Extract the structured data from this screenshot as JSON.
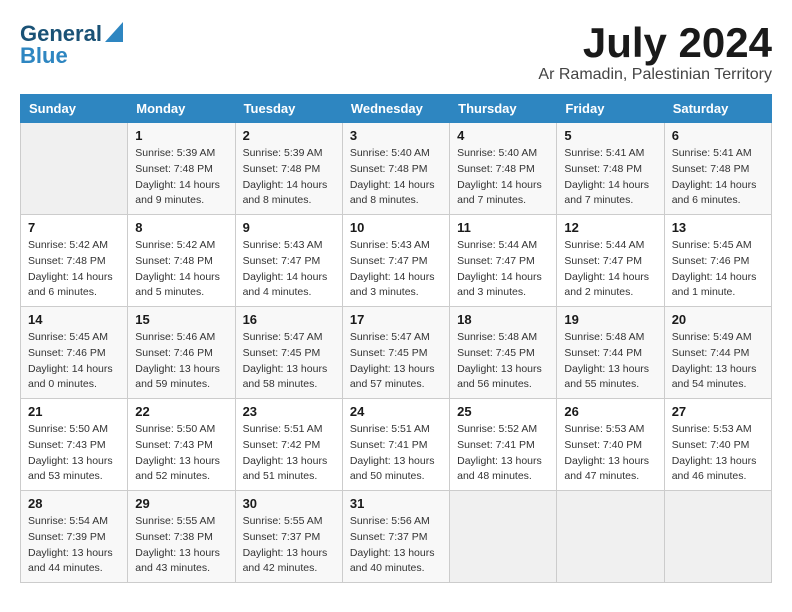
{
  "header": {
    "logo_line1": "General",
    "logo_line2": "Blue",
    "month": "July 2024",
    "location": "Ar Ramadin, Palestinian Territory"
  },
  "weekdays": [
    "Sunday",
    "Monday",
    "Tuesday",
    "Wednesday",
    "Thursday",
    "Friday",
    "Saturday"
  ],
  "weeks": [
    [
      {
        "day": "",
        "info": ""
      },
      {
        "day": "1",
        "info": "Sunrise: 5:39 AM\nSunset: 7:48 PM\nDaylight: 14 hours\nand 9 minutes."
      },
      {
        "day": "2",
        "info": "Sunrise: 5:39 AM\nSunset: 7:48 PM\nDaylight: 14 hours\nand 8 minutes."
      },
      {
        "day": "3",
        "info": "Sunrise: 5:40 AM\nSunset: 7:48 PM\nDaylight: 14 hours\nand 8 minutes."
      },
      {
        "day": "4",
        "info": "Sunrise: 5:40 AM\nSunset: 7:48 PM\nDaylight: 14 hours\nand 7 minutes."
      },
      {
        "day": "5",
        "info": "Sunrise: 5:41 AM\nSunset: 7:48 PM\nDaylight: 14 hours\nand 7 minutes."
      },
      {
        "day": "6",
        "info": "Sunrise: 5:41 AM\nSunset: 7:48 PM\nDaylight: 14 hours\nand 6 minutes."
      }
    ],
    [
      {
        "day": "7",
        "info": "Sunrise: 5:42 AM\nSunset: 7:48 PM\nDaylight: 14 hours\nand 6 minutes."
      },
      {
        "day": "8",
        "info": "Sunrise: 5:42 AM\nSunset: 7:48 PM\nDaylight: 14 hours\nand 5 minutes."
      },
      {
        "day": "9",
        "info": "Sunrise: 5:43 AM\nSunset: 7:47 PM\nDaylight: 14 hours\nand 4 minutes."
      },
      {
        "day": "10",
        "info": "Sunrise: 5:43 AM\nSunset: 7:47 PM\nDaylight: 14 hours\nand 3 minutes."
      },
      {
        "day": "11",
        "info": "Sunrise: 5:44 AM\nSunset: 7:47 PM\nDaylight: 14 hours\nand 3 minutes."
      },
      {
        "day": "12",
        "info": "Sunrise: 5:44 AM\nSunset: 7:47 PM\nDaylight: 14 hours\nand 2 minutes."
      },
      {
        "day": "13",
        "info": "Sunrise: 5:45 AM\nSunset: 7:46 PM\nDaylight: 14 hours\nand 1 minute."
      }
    ],
    [
      {
        "day": "14",
        "info": "Sunrise: 5:45 AM\nSunset: 7:46 PM\nDaylight: 14 hours\nand 0 minutes."
      },
      {
        "day": "15",
        "info": "Sunrise: 5:46 AM\nSunset: 7:46 PM\nDaylight: 13 hours\nand 59 minutes."
      },
      {
        "day": "16",
        "info": "Sunrise: 5:47 AM\nSunset: 7:45 PM\nDaylight: 13 hours\nand 58 minutes."
      },
      {
        "day": "17",
        "info": "Sunrise: 5:47 AM\nSunset: 7:45 PM\nDaylight: 13 hours\nand 57 minutes."
      },
      {
        "day": "18",
        "info": "Sunrise: 5:48 AM\nSunset: 7:45 PM\nDaylight: 13 hours\nand 56 minutes."
      },
      {
        "day": "19",
        "info": "Sunrise: 5:48 AM\nSunset: 7:44 PM\nDaylight: 13 hours\nand 55 minutes."
      },
      {
        "day": "20",
        "info": "Sunrise: 5:49 AM\nSunset: 7:44 PM\nDaylight: 13 hours\nand 54 minutes."
      }
    ],
    [
      {
        "day": "21",
        "info": "Sunrise: 5:50 AM\nSunset: 7:43 PM\nDaylight: 13 hours\nand 53 minutes."
      },
      {
        "day": "22",
        "info": "Sunrise: 5:50 AM\nSunset: 7:43 PM\nDaylight: 13 hours\nand 52 minutes."
      },
      {
        "day": "23",
        "info": "Sunrise: 5:51 AM\nSunset: 7:42 PM\nDaylight: 13 hours\nand 51 minutes."
      },
      {
        "day": "24",
        "info": "Sunrise: 5:51 AM\nSunset: 7:41 PM\nDaylight: 13 hours\nand 50 minutes."
      },
      {
        "day": "25",
        "info": "Sunrise: 5:52 AM\nSunset: 7:41 PM\nDaylight: 13 hours\nand 48 minutes."
      },
      {
        "day": "26",
        "info": "Sunrise: 5:53 AM\nSunset: 7:40 PM\nDaylight: 13 hours\nand 47 minutes."
      },
      {
        "day": "27",
        "info": "Sunrise: 5:53 AM\nSunset: 7:40 PM\nDaylight: 13 hours\nand 46 minutes."
      }
    ],
    [
      {
        "day": "28",
        "info": "Sunrise: 5:54 AM\nSunset: 7:39 PM\nDaylight: 13 hours\nand 44 minutes."
      },
      {
        "day": "29",
        "info": "Sunrise: 5:55 AM\nSunset: 7:38 PM\nDaylight: 13 hours\nand 43 minutes."
      },
      {
        "day": "30",
        "info": "Sunrise: 5:55 AM\nSunset: 7:37 PM\nDaylight: 13 hours\nand 42 minutes."
      },
      {
        "day": "31",
        "info": "Sunrise: 5:56 AM\nSunset: 7:37 PM\nDaylight: 13 hours\nand 40 minutes."
      },
      {
        "day": "",
        "info": ""
      },
      {
        "day": "",
        "info": ""
      },
      {
        "day": "",
        "info": ""
      }
    ]
  ]
}
